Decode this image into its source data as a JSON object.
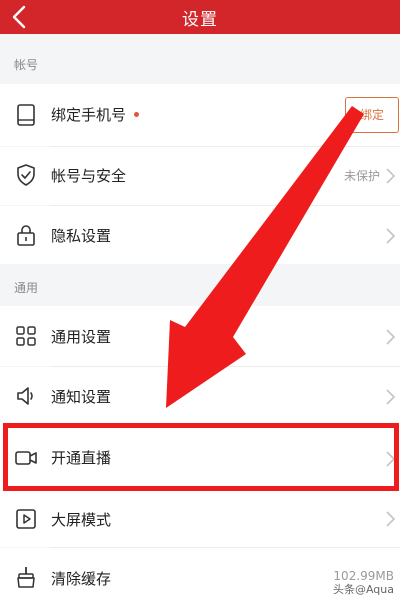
{
  "header": {
    "title": "设置"
  },
  "sections": [
    {
      "label": "帐号"
    },
    {
      "label": "通用"
    }
  ],
  "rows": {
    "bind_phone": {
      "label": "绑定手机号",
      "button": "绑定"
    },
    "account_security": {
      "label": "帐号与安全",
      "value": "未保护"
    },
    "privacy": {
      "label": "隐私设置"
    },
    "general": {
      "label": "通用设置"
    },
    "notifications": {
      "label": "通知设置"
    },
    "live": {
      "label": "开通直播"
    },
    "bigscreen": {
      "label": "大屏模式"
    },
    "clear_cache": {
      "label": "清除缓存",
      "value": "102.99MB"
    }
  },
  "watermark": "头条@Aqua",
  "colors": {
    "header": "#d2262b",
    "annotation": "#ee1c1c",
    "accent": "#d9733e"
  },
  "icons": [
    "back-arrow-icon",
    "tablet-icon",
    "shield-check-icon",
    "lock-icon",
    "grid-icon",
    "speaker-icon",
    "video-camera-icon",
    "play-square-icon",
    "broom-icon",
    "chevron-right-icon"
  ]
}
